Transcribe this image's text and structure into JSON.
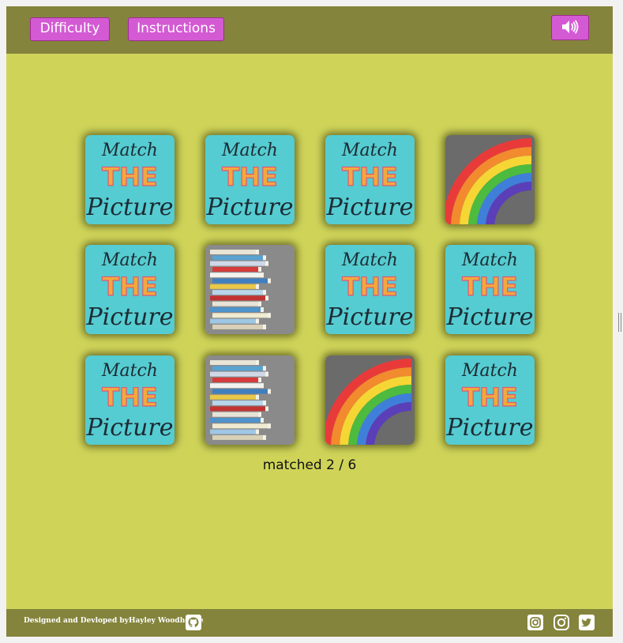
{
  "header": {
    "difficulty_label": "Difficulty",
    "instructions_label": "Instructions",
    "sound_icon": "volume-up-icon"
  },
  "card_back": {
    "line1": "Match",
    "line2": "THE",
    "line3": "Picture"
  },
  "board": {
    "columns": 4,
    "rows": 3,
    "cards": [
      {
        "state": "hidden",
        "face": "match-the-picture-logo"
      },
      {
        "state": "hidden",
        "face": "match-the-picture-logo"
      },
      {
        "state": "hidden",
        "face": "match-the-picture-logo"
      },
      {
        "state": "revealed",
        "face": "rainbow"
      },
      {
        "state": "hidden",
        "face": "match-the-picture-logo"
      },
      {
        "state": "revealed",
        "face": "books"
      },
      {
        "state": "hidden",
        "face": "match-the-picture-logo"
      },
      {
        "state": "hidden",
        "face": "match-the-picture-logo"
      },
      {
        "state": "hidden",
        "face": "match-the-picture-logo"
      },
      {
        "state": "revealed",
        "face": "books"
      },
      {
        "state": "revealed",
        "face": "rainbow"
      },
      {
        "state": "hidden",
        "face": "match-the-picture-logo"
      }
    ]
  },
  "status": {
    "text": "matched 2 / 6"
  },
  "footer": {
    "credit": "Designed and Devloped byHayley Woodhouse",
    "icons": [
      "github-icon",
      "instagram-icon",
      "instagram-icon",
      "twitter-icon"
    ]
  },
  "colors": {
    "page_bg": "#cfd459",
    "bar_bg": "#84843c",
    "button_bg": "#d45ad4",
    "card_back_bg": "#55ccd1"
  }
}
